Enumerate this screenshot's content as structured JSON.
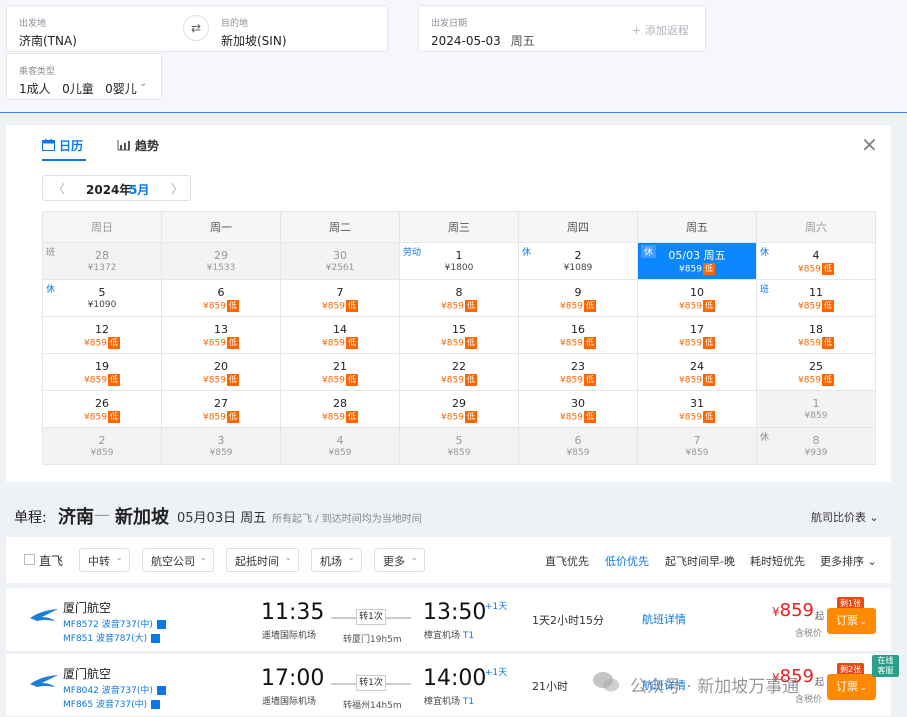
{
  "search": {
    "from_label": "出发地",
    "from_value": "济南(TNA)",
    "to_label": "目的地",
    "to_value": "新加坡(SIN)",
    "swap_icon": "⇄",
    "date_label": "出发日期",
    "date_value": "2024-05-03",
    "date_weekday": "周五",
    "add_return": "+ 添加返程",
    "pax_label": "乘客类型",
    "pax_value": "1成人   0儿童   0婴儿",
    "pax_caret": "⌄"
  },
  "calendar": {
    "tab_calendar": "日历",
    "tab_trend": "趋势",
    "close": "✕",
    "year": "2024年",
    "month": "5月",
    "prev": "〈",
    "next": "〉",
    "weekdays": [
      "周日",
      "周一",
      "周二",
      "周三",
      "周四",
      "周五",
      "周六"
    ],
    "weeks": [
      [
        {
          "day": "28",
          "price": "¥1372",
          "tag": "班",
          "off": true
        },
        {
          "day": "29",
          "price": "¥1533",
          "off": true
        },
        {
          "day": "30",
          "price": "¥2561",
          "off": true
        },
        {
          "day": "1",
          "price": "¥1800",
          "tag": "劳动"
        },
        {
          "day": "2",
          "price": "¥1089",
          "tag": "休"
        },
        {
          "day": "05/03 周五",
          "price": "¥859",
          "tag": "休",
          "low": true,
          "sel": true
        },
        {
          "day": "4",
          "price": "¥859",
          "tag": "休",
          "low": true
        }
      ],
      [
        {
          "day": "5",
          "price": "¥1090",
          "tag": "休"
        },
        {
          "day": "6",
          "price": "¥859",
          "low": true
        },
        {
          "day": "7",
          "price": "¥859",
          "low": true
        },
        {
          "day": "8",
          "price": "¥859",
          "low": true
        },
        {
          "day": "9",
          "price": "¥859",
          "low": true
        },
        {
          "day": "10",
          "price": "¥859",
          "low": true
        },
        {
          "day": "11",
          "price": "¥859",
          "tag": "班",
          "low": true
        }
      ],
      [
        {
          "day": "12",
          "price": "¥859",
          "low": true
        },
        {
          "day": "13",
          "price": "¥859",
          "low": true
        },
        {
          "day": "14",
          "price": "¥859",
          "low": true
        },
        {
          "day": "15",
          "price": "¥859",
          "low": true
        },
        {
          "day": "16",
          "price": "¥859",
          "low": true
        },
        {
          "day": "17",
          "price": "¥859",
          "low": true
        },
        {
          "day": "18",
          "price": "¥859",
          "low": true
        }
      ],
      [
        {
          "day": "19",
          "price": "¥859",
          "low": true
        },
        {
          "day": "20",
          "price": "¥859",
          "low": true
        },
        {
          "day": "21",
          "price": "¥859",
          "low": true
        },
        {
          "day": "22",
          "price": "¥859",
          "low": true
        },
        {
          "day": "23",
          "price": "¥859",
          "low": true
        },
        {
          "day": "24",
          "price": "¥859",
          "low": true
        },
        {
          "day": "25",
          "price": "¥859",
          "low": true
        }
      ],
      [
        {
          "day": "26",
          "price": "¥859",
          "low": true
        },
        {
          "day": "27",
          "price": "¥859",
          "low": true
        },
        {
          "day": "28",
          "price": "¥859",
          "low": true
        },
        {
          "day": "29",
          "price": "¥859",
          "low": true
        },
        {
          "day": "30",
          "price": "¥859",
          "low": true
        },
        {
          "day": "31",
          "price": "¥859",
          "low": true
        },
        {
          "day": "1",
          "price": "¥859",
          "off": true
        }
      ],
      [
        {
          "day": "2",
          "price": "¥859",
          "off": true
        },
        {
          "day": "3",
          "price": "¥859",
          "off": true
        },
        {
          "day": "4",
          "price": "¥859",
          "off": true
        },
        {
          "day": "5",
          "price": "¥859",
          "off": true
        },
        {
          "day": "6",
          "price": "¥859",
          "off": true
        },
        {
          "day": "7",
          "price": "¥859",
          "off": true
        },
        {
          "day": "8",
          "price": "¥939",
          "tag": "休",
          "off": true
        }
      ]
    ],
    "low_badge": "低"
  },
  "route": {
    "one_way": "单程:",
    "from": "济南",
    "arrow": "—",
    "to": "新加坡",
    "date": "05月03日 周五",
    "note": "所有起飞 / 到达时间均为当地时间",
    "compare": "航司比价表 ⌄"
  },
  "filters": {
    "direct": "直飞",
    "dropdowns": [
      "中转",
      "航空公司",
      "起抵时间",
      "机场",
      "更多"
    ],
    "sorts": [
      "直飞优先",
      "低价优先",
      "起飞时间早-晚",
      "耗时短优先",
      "更多排序 ⌄"
    ],
    "active_sort": 1
  },
  "flights": [
    {
      "airline": "厦门航空",
      "leg1": "MF8572 波音737(中)",
      "leg2": "MF851 波音787(大)",
      "dep_time": "11:35",
      "dep_airport": "遥墙国际机场",
      "transfer": "转1次",
      "via": "转厦门19h5m",
      "arr_time": "13:50",
      "arr_airport": "樟宜机场",
      "arr_terminal": "T1",
      "plus_day": "+1天",
      "duration": "1天2小时15分",
      "detail": "航班详情",
      "currency": "¥",
      "price": "859",
      "qi": "起",
      "tax": "含税价",
      "book": "订票",
      "ribbon": "剩1张"
    },
    {
      "airline": "厦门航空",
      "leg1": "MF8042 波音737(中)",
      "leg2": "MF865 波音737(中)",
      "dep_time": "17:00",
      "dep_airport": "遥墙国际机场",
      "transfer": "转1次",
      "via": "转福州14h5m",
      "arr_time": "14:00",
      "arr_airport": "樟宜机场",
      "arr_terminal": "T1",
      "plus_day": "+1天",
      "duration": "21小时",
      "detail": "航班详情",
      "currency": "¥",
      "price": "859",
      "qi": "起",
      "tax": "含税价",
      "book": "订票",
      "ribbon": "剩2张",
      "service": "在线\n客服"
    }
  ],
  "watermark": "公众号 · 新加坡万事通",
  "colors": {
    "accent": "#0a78e8",
    "selected": "#0a86ff",
    "low": "#ff6600",
    "price": "#e61e1e",
    "book": "#ff8a00"
  }
}
